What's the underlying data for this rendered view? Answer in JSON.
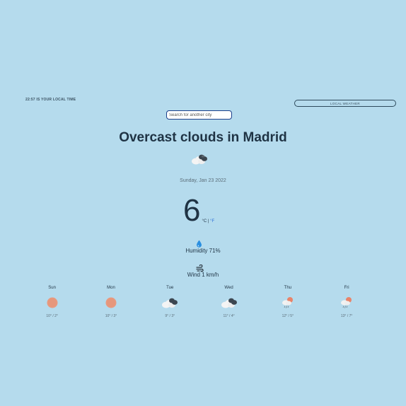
{
  "header": {
    "local_time": "22:57 IS YOUR LOCAL TIME",
    "local_weather_label": "LOCAL WEATHER"
  },
  "search": {
    "placeholder": "Search for another city",
    "value": ""
  },
  "current": {
    "title": "Overcast clouds in Madrid",
    "icon": "overcast-clouds-icon",
    "date": "Sunday, Jan 23 2022",
    "temperature": "6",
    "unit_c": "°C",
    "separator": "|",
    "unit_f": "°F",
    "humidity_icon": "droplet-icon",
    "humidity": "Humidity 71%",
    "wind_icon": "wind-icon",
    "wind": "Wind 1 km/h"
  },
  "forecast": [
    {
      "day": "Sun",
      "icon": "sun-icon",
      "range": "10° / 2°"
    },
    {
      "day": "Mon",
      "icon": "sun-icon",
      "range": "10° / 3°"
    },
    {
      "day": "Tue",
      "icon": "overcast-clouds-icon",
      "range": "9° / 3°"
    },
    {
      "day": "Wed",
      "icon": "overcast-clouds-icon",
      "range": "11° / 4°"
    },
    {
      "day": "Thu",
      "icon": "rain-sun-icon",
      "range": "12° / 5°"
    },
    {
      "day": "Fri",
      "icon": "rain-sun-icon",
      "range": "13° / 7°"
    }
  ],
  "colors": {
    "background": "#b5dbed",
    "text": "#1f3344",
    "accent": "#2e6fd8",
    "sun": "#e89a80"
  }
}
